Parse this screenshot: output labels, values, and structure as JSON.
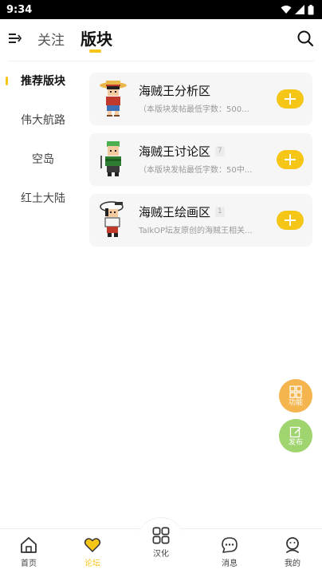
{
  "status_bar": {
    "time": "9:34"
  },
  "header": {
    "tab_follow": "关注",
    "tab_boards": "版块"
  },
  "sidebar": {
    "items": [
      {
        "label": "推荐版块",
        "active": true
      },
      {
        "label": "伟大航路",
        "active": false
      },
      {
        "label": "空岛",
        "active": false
      },
      {
        "label": "红土大陆",
        "active": false
      }
    ]
  },
  "boards": [
    {
      "title": "海贼王分析区",
      "count": "",
      "desc": "（本版块发帖最低字数：500..."
    },
    {
      "title": "海贼王讨论区",
      "count": "7",
      "desc": "（本版块发帖最低字数：50中..."
    },
    {
      "title": "海贼王绘画区",
      "count": "1",
      "desc": "TalkOP坛友原创的海贼王相关..."
    }
  ],
  "fabs": {
    "function_label": "功能",
    "post_label": "发布"
  },
  "bottom_nav": {
    "items": [
      {
        "label": "首页"
      },
      {
        "label": "论坛"
      },
      {
        "label": "汉化"
      },
      {
        "label": "消息"
      },
      {
        "label": "我的"
      }
    ]
  },
  "colors": {
    "accent": "#f5c518",
    "fab_function": "#f5b54e",
    "fab_post": "#9fd46e"
  }
}
